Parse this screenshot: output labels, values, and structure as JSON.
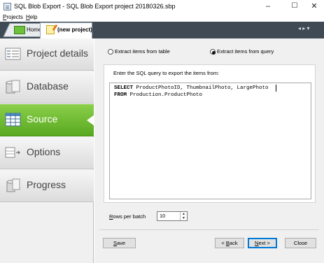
{
  "window": {
    "title": "SQL Blob Export - SQL Blob Export project 20180326.sbp",
    "minimize": "–",
    "maximize": "☐",
    "close": "✕"
  },
  "menu": [
    {
      "label": "Projects",
      "mnemonic": "P"
    },
    {
      "label": "Help",
      "mnemonic": "H"
    }
  ],
  "tabs": {
    "home": "Home",
    "project": "(new project)",
    "nav_symbols": "◂ ▸ ▾"
  },
  "sidebar": {
    "items": [
      {
        "label": "Project details",
        "icon": "project-details-icon",
        "active": false
      },
      {
        "label": "Database",
        "icon": "database-icon",
        "active": false
      },
      {
        "label": "Source",
        "icon": "source-table-icon",
        "active": true
      },
      {
        "label": "Options",
        "icon": "options-icon",
        "active": false
      },
      {
        "label": "Progress",
        "icon": "progress-icon",
        "active": false
      }
    ],
    "active_color": "#6cbb2f"
  },
  "source": {
    "option_table": "Extract items from table",
    "option_query": "Extract items from query",
    "selected": "query",
    "instruction": "Enter the SQL query to export the items from:",
    "sql": {
      "line1_kw": "SELECT",
      "line1_rest": " ProductPhotoID, ThumbnailPhoto, LargePhoto",
      "line2_kw": "FROM",
      "line2_rest": " Production.ProductPhoto"
    },
    "rows_per_batch_label": "Rows per batch",
    "rows_per_batch_value": "10"
  },
  "buttons": {
    "save": "Save",
    "back": "< Back",
    "next": "Next >",
    "close": "Close"
  }
}
